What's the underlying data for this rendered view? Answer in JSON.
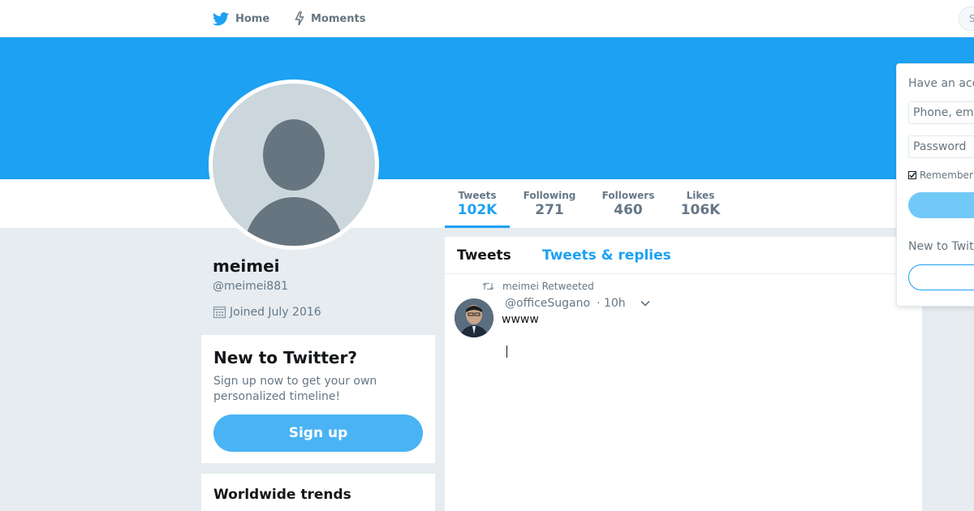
{
  "nav": {
    "home_label": "Home",
    "moments_label": "Moments",
    "search_placeholder": "S"
  },
  "profile": {
    "name": "meimei",
    "handle": "@meimei881",
    "joined": "Joined July 2016"
  },
  "stats": [
    {
      "label": "Tweets",
      "value": "102K",
      "active": true
    },
    {
      "label": "Following",
      "value": "271",
      "active": false
    },
    {
      "label": "Followers",
      "value": "460",
      "active": false
    },
    {
      "label": "Likes",
      "value": "106K",
      "active": false
    }
  ],
  "signup_card": {
    "title": "New to Twitter?",
    "description": "Sign up now to get your own personalized timeline!",
    "button_label": "Sign up"
  },
  "trends": {
    "title": "Worldwide trends"
  },
  "timeline": {
    "tabs": [
      "Tweets",
      "Tweets & replies"
    ],
    "tweet": {
      "retweet_label": "meimei Retweeted",
      "author_handle": "@officeSugano",
      "time": "· 10h",
      "text": "wwww"
    }
  },
  "login": {
    "title": "Have an acc",
    "phone_placeholder": "Phone, ema",
    "password_placeholder": "Password",
    "remember_label": "Remember",
    "new_label": "New to Twit"
  },
  "colors": {
    "brand": "#1da1f2",
    "banner": "#1da1f2",
    "background": "#e6ecf0",
    "muted_text": "#657786",
    "signup_button": "#4ab3f4"
  },
  "icons": {
    "home": "twitter-bird-icon",
    "moments": "lightning-icon",
    "calendar": "calendar-icon",
    "retweet": "retweet-icon",
    "caret": "chevron-down-icon"
  }
}
